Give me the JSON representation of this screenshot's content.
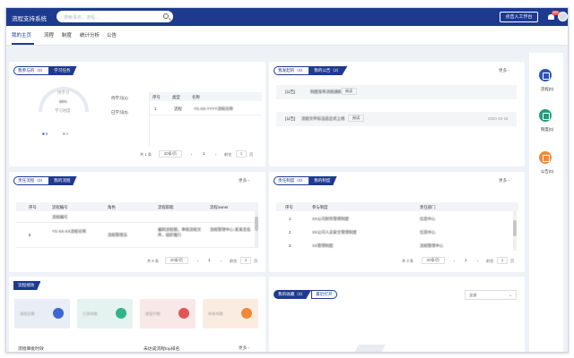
{
  "header": {
    "title": "流程支持系统",
    "search_placeholder": "搜索事务、流程...",
    "enter_workbench": "点击入工作台",
    "notification_count": "99+"
  },
  "tabs": [
    {
      "label": "我的主页",
      "active": true
    },
    {
      "label": "流程",
      "active": false
    },
    {
      "label": "制度",
      "active": false
    },
    {
      "label": "统计分析",
      "active": false
    },
    {
      "label": "公告",
      "active": false
    }
  ],
  "panel_tasks": {
    "tab_a": "我参与的（0）",
    "tab_b": "学习任务",
    "gauge_label": "待学习",
    "gauge_value": "66%",
    "gauge_caption": "学习进度",
    "legend_a": "0",
    "legend_b": "0",
    "left_stats": [
      "待学习(1)",
      "已学习(0)"
    ],
    "table_headers": [
      "序号",
      "类型",
      "名称"
    ],
    "rows": [
      {
        "no": "1",
        "type": "流程",
        "name": "YS-XX-YYYY流程名称"
      }
    ],
    "pager_total": "共 1 条",
    "pager_size": "20条/页",
    "pager_page": "1",
    "pager_goto": "前往",
    "pager_goto_val": "1",
    "pager_unit": "页"
  },
  "panel_notice": {
    "tab_a": "我发起的（0）",
    "tab_b": "我的公告（2）",
    "more": "更多",
    "items": [
      {
        "tag": "[公告]",
        "title": "制度发布流程通知",
        "btn": "阅读",
        "date": ""
      },
      {
        "tag": "[公告]",
        "title": "流程文件标注后正式上线",
        "btn": "阅读",
        "date": "2020-10-18"
      }
    ]
  },
  "panel_process": {
    "tab_a": "责任流程（0）",
    "tab_b": "我的流程",
    "more": "更多",
    "headers": [
      "序号",
      "流程编号",
      "角色",
      "流程职能",
      "流程owner"
    ],
    "rows": [
      {
        "no": "",
        "code": "流程编号",
        "role": "",
        "duty": "",
        "owner": ""
      },
      {
        "no": "5",
        "code": "YS-XX-XX流程名称",
        "role": "流程管理员",
        "duty": "编制流程图，审核流程文件，组织推行",
        "owner": "流程管理中心-某某总监"
      },
      {
        "no": "",
        "code": "",
        "role": "",
        "duty": "",
        "owner": ""
      }
    ],
    "pager_total": "共 5 条",
    "pager_size": "20条/页",
    "pager_page": "1",
    "pager_goto": "前往",
    "pager_goto_val": "1",
    "pager_unit": "页"
  },
  "panel_system": {
    "tab_a": "责任制度（0）",
    "tab_b": "我的制度",
    "more": "更多",
    "headers": [
      "序号",
      "参与制度",
      "责任部门"
    ],
    "rows": [
      {
        "no": "1",
        "name": "XX公司财务管理制度",
        "dept": "信息中心"
      },
      {
        "no": "2",
        "name": "XX公司人员安全管理制度",
        "dept": "信息中心"
      },
      {
        "no": "3",
        "name": "XX管理制度",
        "dept": "流程管理中心"
      }
    ],
    "pager_total": "共 3 条",
    "pager_size": "20条/页",
    "pager_page": "1",
    "pager_goto": "前往",
    "pager_goto_val": "1",
    "pager_unit": "页"
  },
  "panel_perf": {
    "title": "流程绩效",
    "cards": [
      {
        "label": "流程总数",
        "color": "#e8edf6",
        "icon_color": "#3e67d1",
        "icon": "chart-icon"
      },
      {
        "label": "已发布数",
        "color": "#e4f3ef",
        "icon_color": "#34b38a",
        "icon": "check-icon"
      },
      {
        "label": "审批中数",
        "color": "#f8e8e8",
        "icon_color": "#e05656",
        "icon": "alert-icon"
      },
      {
        "label": "待发布数",
        "color": "#fbece2",
        "icon_color": "#f0883a",
        "icon": "pie-icon"
      }
    ],
    "footer_left": "流程审批时效",
    "footer_mid": "未达成流程top排名",
    "more": "更多"
  },
  "panel_fav": {
    "tab_a": "我的收藏（0）",
    "tab_b": "最近打开",
    "select_value": "全部"
  },
  "sidebar": [
    {
      "label": "流程(0)",
      "color": "#2a55b8",
      "icon": "process-icon"
    },
    {
      "label": "制度(0)",
      "color": "#1f9e7a",
      "icon": "system-icon"
    },
    {
      "label": "公告(0)",
      "color": "#f0883a",
      "icon": "notice-icon"
    }
  ]
}
